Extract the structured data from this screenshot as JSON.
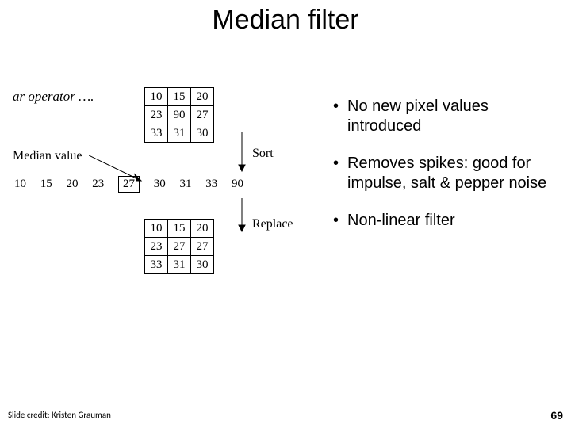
{
  "title": "Median filter",
  "bullets": [
    "No new pixel values introduced",
    "Removes spikes: good for impulse, salt & pepper noise",
    "Non-linear filter"
  ],
  "credit": "Slide credit: Kristen Grauman",
  "page_number": "69",
  "diagram": {
    "operator_label": "ar operator ….",
    "median_label": "Median value",
    "sort_label": "Sort",
    "replace_label": "Replace",
    "grid_before": [
      [
        "10",
        "15",
        "20"
      ],
      [
        "23",
        "90",
        "27"
      ],
      [
        "33",
        "31",
        "30"
      ]
    ],
    "sorted_values": [
      "10",
      "15",
      "20",
      "23",
      "27",
      "30",
      "31",
      "33",
      "90"
    ],
    "median_index": 4,
    "grid_after": [
      [
        "10",
        "15",
        "20"
      ],
      [
        "23",
        "27",
        "27"
      ],
      [
        "33",
        "31",
        "30"
      ]
    ]
  }
}
